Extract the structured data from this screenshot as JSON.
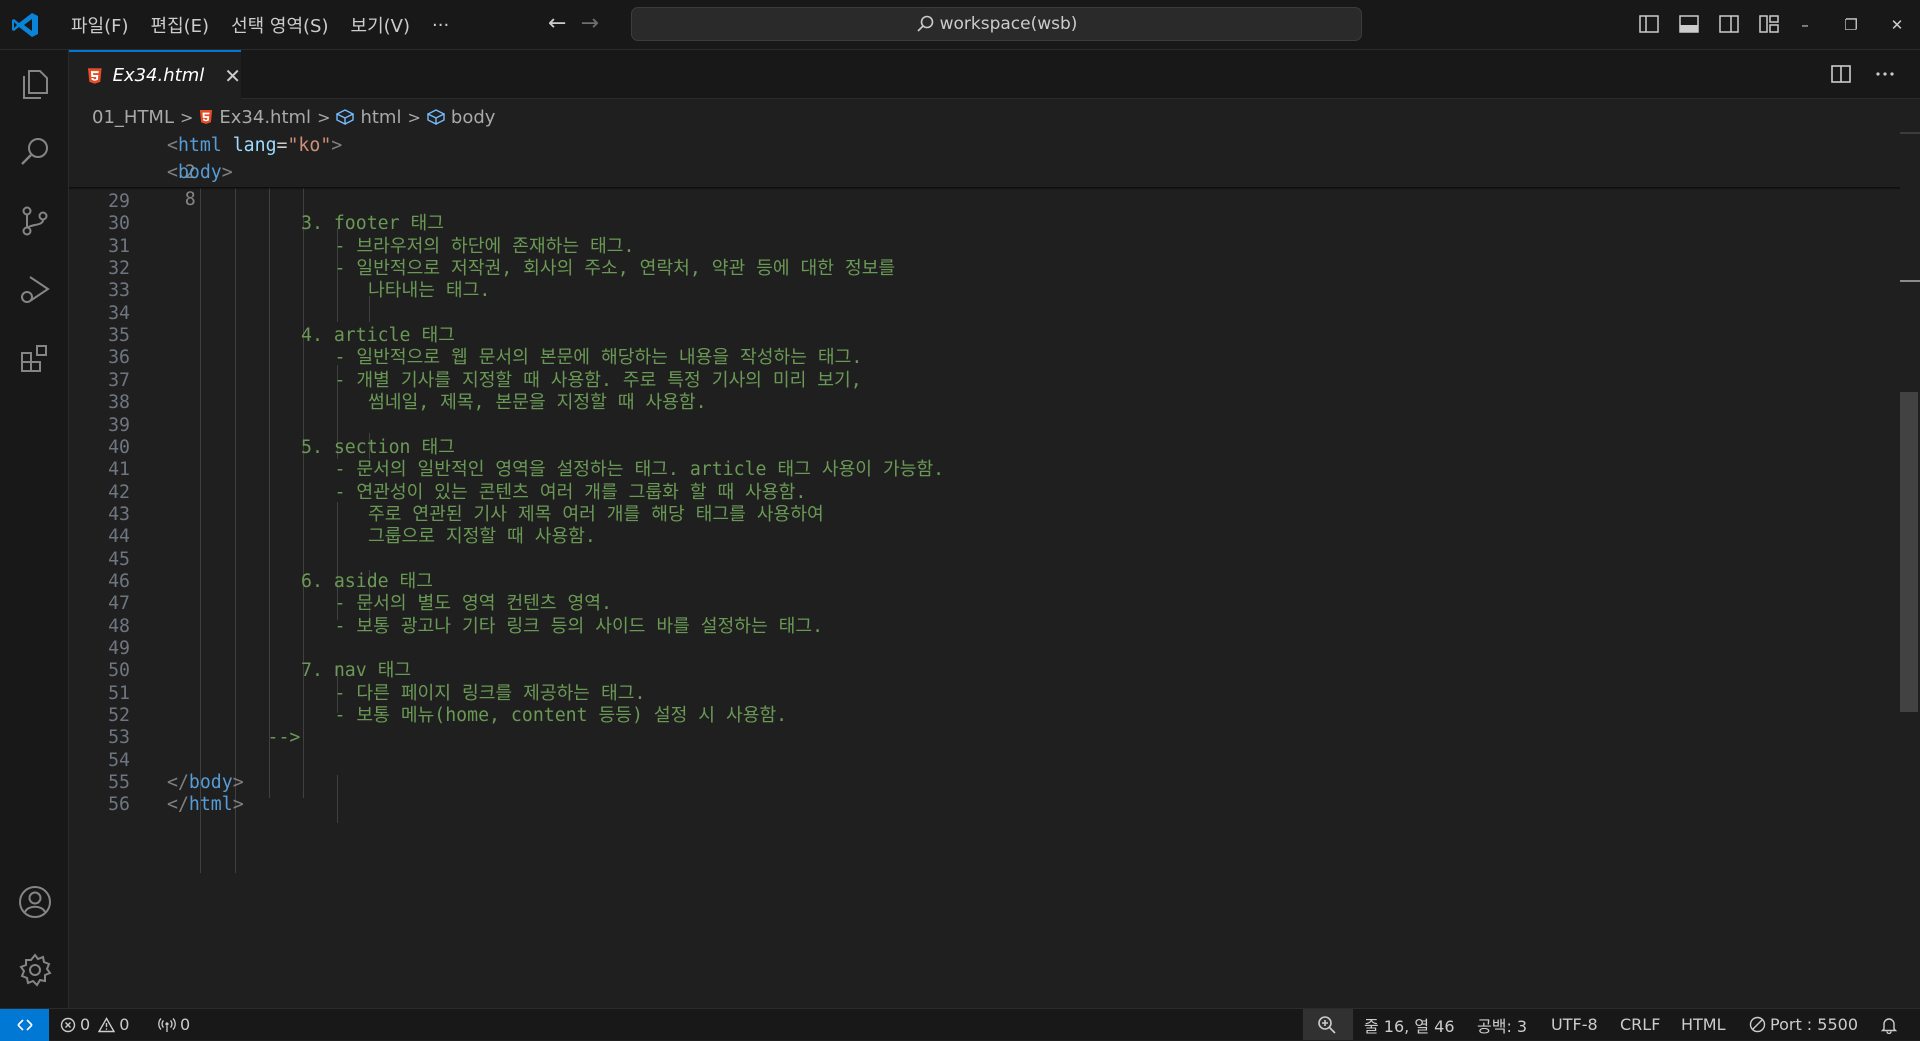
{
  "menu": [
    "파일(F)",
    "편집(E)",
    "선택 영역(S)",
    "보기(V)",
    "···"
  ],
  "search": {
    "label": "workspace(wsb)"
  },
  "window_controls": [
    "–",
    "❐",
    "✕"
  ],
  "tab": {
    "name": "Ex34.html",
    "close": "✕"
  },
  "breadcrumb": {
    "folder": "01_HTML",
    "file": "Ex34.html",
    "el1": "html",
    "el2": "body",
    "sep": ">"
  },
  "editor": {
    "sticky_lines": [
      {
        "n": "2",
        "tag_open": "<",
        "tag": "html",
        "attr": " lang",
        "eq": "=",
        "str": "\"ko\"",
        "tag_close": ">"
      },
      {
        "n": "8",
        "tag_open": "<",
        "tag": "body",
        "tag_close": ">"
      }
    ],
    "lines": [
      {
        "n": "29",
        "text": ""
      },
      {
        "n": "30",
        "text": "3. footer 태그"
      },
      {
        "n": "31",
        "text": "- 브라우저의 하단에 존재하는 태그."
      },
      {
        "n": "32",
        "text": "- 일반적으로 저작권, 회사의 주소, 연락처, 약관 등에 대한 정보를"
      },
      {
        "n": "33",
        "text": "나타내는 태그."
      },
      {
        "n": "34",
        "text": ""
      },
      {
        "n": "35",
        "text": "4. article 태그"
      },
      {
        "n": "36",
        "text": "- 일반적으로 웹 문서의 본문에 해당하는 내용을 작성하는 태그."
      },
      {
        "n": "37",
        "text": "- 개별 기사를 지정할 때 사용함. 주로 특정 기사의 미리 보기,"
      },
      {
        "n": "38",
        "text": "썸네일, 제목, 본문을 지정할 때 사용함."
      },
      {
        "n": "39",
        "text": ""
      },
      {
        "n": "40",
        "text": "5. section 태그"
      },
      {
        "n": "41",
        "text": "- 문서의 일반적인 영역을 설정하는 태그. article 태그 사용이 가능함."
      },
      {
        "n": "42",
        "text": "- 연관성이 있는 콘텐츠 여러 개를 그룹화 할 때 사용함."
      },
      {
        "n": "43",
        "text": "주로 연관된 기사 제목 여러 개를 해당 태그를 사용하여"
      },
      {
        "n": "44",
        "text": "그룹으로 지정할 때 사용함."
      },
      {
        "n": "45",
        "text": ""
      },
      {
        "n": "46",
        "text": "6. aside 태그"
      },
      {
        "n": "47",
        "text": "- 문서의 별도 영역 컨텐츠 영역."
      },
      {
        "n": "48",
        "text": "- 보통 광고나 기타 링크 등의 사이드 바를 설정하는 태그."
      },
      {
        "n": "49",
        "text": ""
      },
      {
        "n": "50",
        "text": "7. nav 태그"
      },
      {
        "n": "51",
        "text": "- 다른 페이지 링크를 제공하는 태그."
      },
      {
        "n": "52",
        "text": "- 보통 메뉴(home, content 등등) 설정 시 사용함."
      },
      {
        "n": "53",
        "text": "-->"
      },
      {
        "n": "54",
        "text": ""
      },
      {
        "n": "55",
        "tag_open": "</",
        "tag": "body",
        "tag_close": ">"
      },
      {
        "n": "56",
        "tag_open": "</",
        "tag": "html",
        "tag_close": ">"
      }
    ]
  },
  "status": {
    "errors": "0",
    "warnings": "0",
    "ports": "0",
    "position": "줄 16, 열 46",
    "indent": "공백: 3",
    "encoding": "UTF-8",
    "eol": "CRLF",
    "language": "HTML",
    "port": "Port : 5500"
  },
  "colors": {
    "accent": "#0078d4",
    "comment": "#6a9955",
    "tag": "#569cd6",
    "string": "#ce9178",
    "attr": "#9cdcfe"
  }
}
